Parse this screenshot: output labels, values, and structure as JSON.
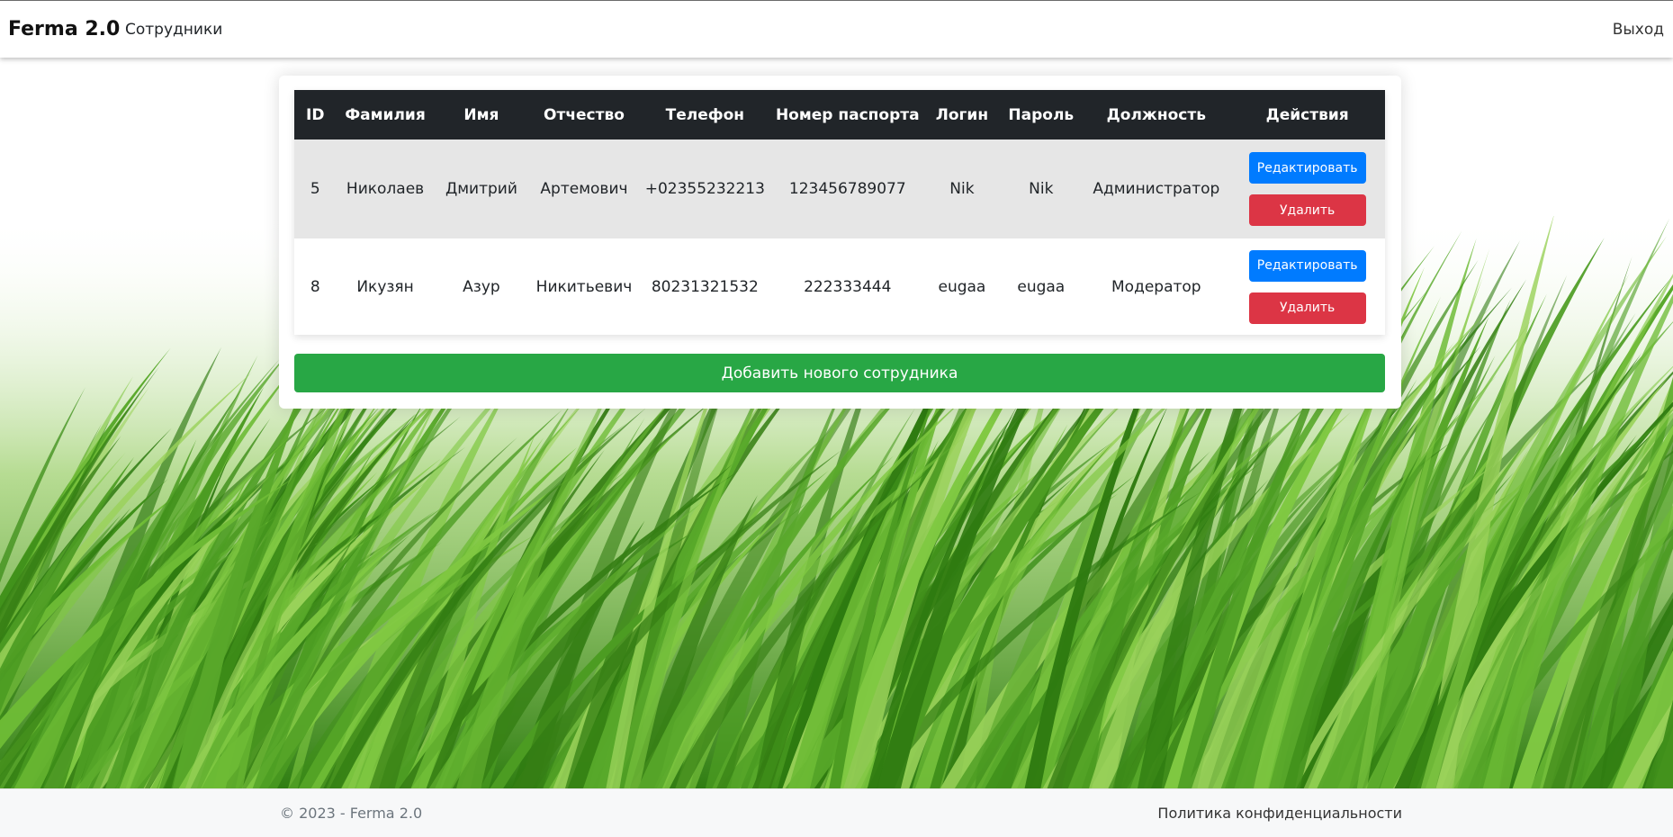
{
  "navbar": {
    "brand": "Ferma 2.0",
    "employees_link": "Сотрудники",
    "logout_link": "Выход"
  },
  "table": {
    "headers": [
      "ID",
      "Фамилия",
      "Имя",
      "Отчество",
      "Телефон",
      "Номер паспорта",
      "Логин",
      "Пароль",
      "Должность",
      "Действия"
    ],
    "rows": [
      {
        "id": "5",
        "last_name": "Николаев",
        "first_name": "Дмитрий",
        "patronymic": "Артемович",
        "phone": "+02355232213",
        "passport": "123456789077",
        "login": "Nik",
        "password": "Nik",
        "position": "Администратор",
        "edit_label": "Редактировать",
        "delete_label": "Удалить"
      },
      {
        "id": "8",
        "last_name": "Икузян",
        "first_name": "Азур",
        "patronymic": "Никитьевич",
        "phone": "80231321532",
        "passport": "222333444",
        "login": "eugaa",
        "password": "eugaa",
        "position": "Модератор",
        "edit_label": "Редактировать",
        "delete_label": "Удалить"
      }
    ]
  },
  "add_button_label": "Добавить нового сотрудника",
  "footer": {
    "copyright": "© 2023 - Ferma 2.0",
    "privacy_link": "Политика конфиденциальности"
  },
  "colors": {
    "header_bg": "#212529",
    "edit_button": "#007bff",
    "delete_button": "#dc3545",
    "add_button": "#28a745",
    "footer_bg": "#f7f8f9"
  }
}
